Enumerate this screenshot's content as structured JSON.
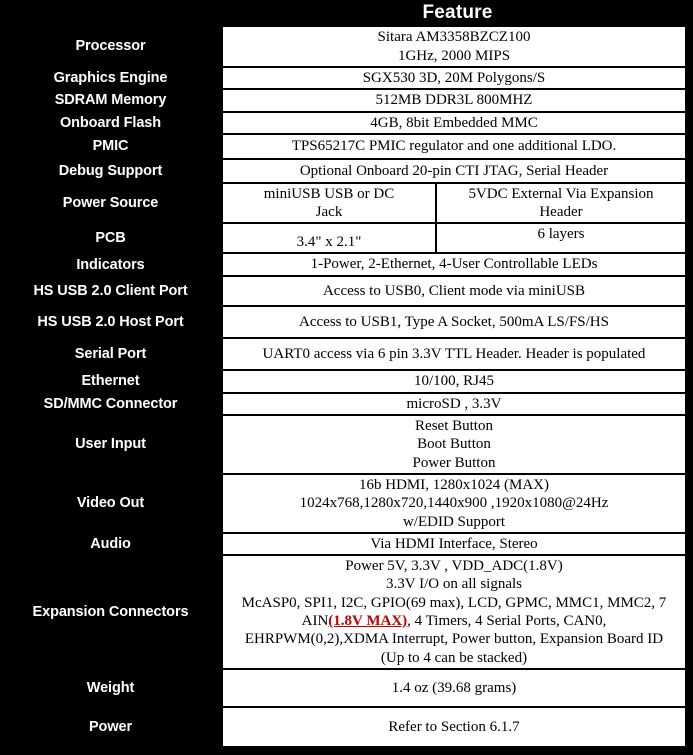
{
  "table": {
    "header": {
      "label_col": "",
      "feature": "Feature"
    },
    "rows": [
      {
        "label": "Processor",
        "lines": [
          "Sitara AM3358BZCZ100",
          "1GHz, 2000 MIPS"
        ],
        "split": false
      },
      {
        "label": "Graphics Engine",
        "lines": [
          "SGX530 3D, 20M Polygons/S"
        ],
        "split": false
      },
      {
        "label": "SDRAM Memory",
        "lines": [
          "512MB DDR3L 800MHZ"
        ],
        "split": false
      },
      {
        "label": "Onboard Flash",
        "lines": [
          "4GB, 8bit Embedded MMC"
        ],
        "split": false
      },
      {
        "label": "PMIC",
        "lines": [
          "TPS65217C PMIC regulator and one additional LDO."
        ],
        "split": false
      },
      {
        "label": "Debug Support",
        "lines": [
          "Optional Onboard 20-pin CTI JTAG, Serial Header"
        ],
        "split": false
      },
      {
        "label": "Power Source",
        "split": true,
        "left_lines": [
          "miniUSB USB or DC",
          "Jack"
        ],
        "right_lines": [
          "5VDC  External Via Expansion",
          "Header"
        ]
      },
      {
        "label": "PCB",
        "split": true,
        "left_lines": [
          "3.4\" x 2.1\""
        ],
        "right_lines": [
          "6 layers"
        ]
      },
      {
        "label": "Indicators",
        "lines": [
          "1-Power, 2-Ethernet, 4-User Controllable LEDs"
        ],
        "split": false
      },
      {
        "label": "HS USB 2.0 Client Port",
        "lines": [
          "Access to USB0, Client mode via miniUSB"
        ],
        "split": false
      },
      {
        "label": "HS USB 2.0 Host Port",
        "lines": [
          "Access to USB1, Type A Socket, 500mA LS/FS/HS"
        ],
        "split": false
      },
      {
        "label": "Serial Port",
        "lines": [
          "UART0 access via 6 pin 3.3V TTL Header. Header is populated"
        ],
        "split": false
      },
      {
        "label": "Ethernet",
        "lines": [
          "10/100, RJ45"
        ],
        "split": false
      },
      {
        "label": "SD/MMC Connector",
        "lines": [
          "microSD , 3.3V"
        ],
        "split": false
      },
      {
        "label": "User Input",
        "lines": [
          "Reset Button",
          "Boot Button",
          "Power Button"
        ],
        "split": false
      },
      {
        "label": "Video Out",
        "lines": [
          "16b HDMI, 1280x1024 (MAX)",
          "1024x768,1280x720,1440x900 ,1920x1080@24Hz",
          "w/EDID Support"
        ],
        "split": false
      },
      {
        "label": "Audio",
        "lines": [
          "Via HDMI Interface, Stereo"
        ],
        "split": false
      },
      {
        "label": "Expansion Connectors",
        "split": false,
        "rich": true,
        "lines": [
          "Power 5V, 3.3V , VDD_ADC(1.8V)",
          "3.3V I/O on all signals",
          "McASP0, SPI1, I2C, GPIO(69 max), LCD, GPMC, MMC1, MMC2, 7",
          "EHRPWM(0,2),XDMA Interrupt, Power button, Expansion Board ID",
          "(Up to 4 can be stacked)"
        ],
        "warn_line_prefix": "AIN",
        "warn_text": "(1.8V MAX)",
        "warn_line_suffix": ", 4 Timers,  4 Serial Ports, CAN0,"
      },
      {
        "label": "Weight",
        "lines": [
          "1.4 oz (39.68 grams)"
        ],
        "split": false
      },
      {
        "label": "Power",
        "lines": [
          "Refer to Section 6.1.7"
        ],
        "split": false
      }
    ]
  },
  "colors": {
    "label_background": "#000000",
    "label_text": "#ffffff",
    "value_background": "#ffffff",
    "value_text": "#000000",
    "warning_text": "#c00000",
    "border": "#000000"
  }
}
